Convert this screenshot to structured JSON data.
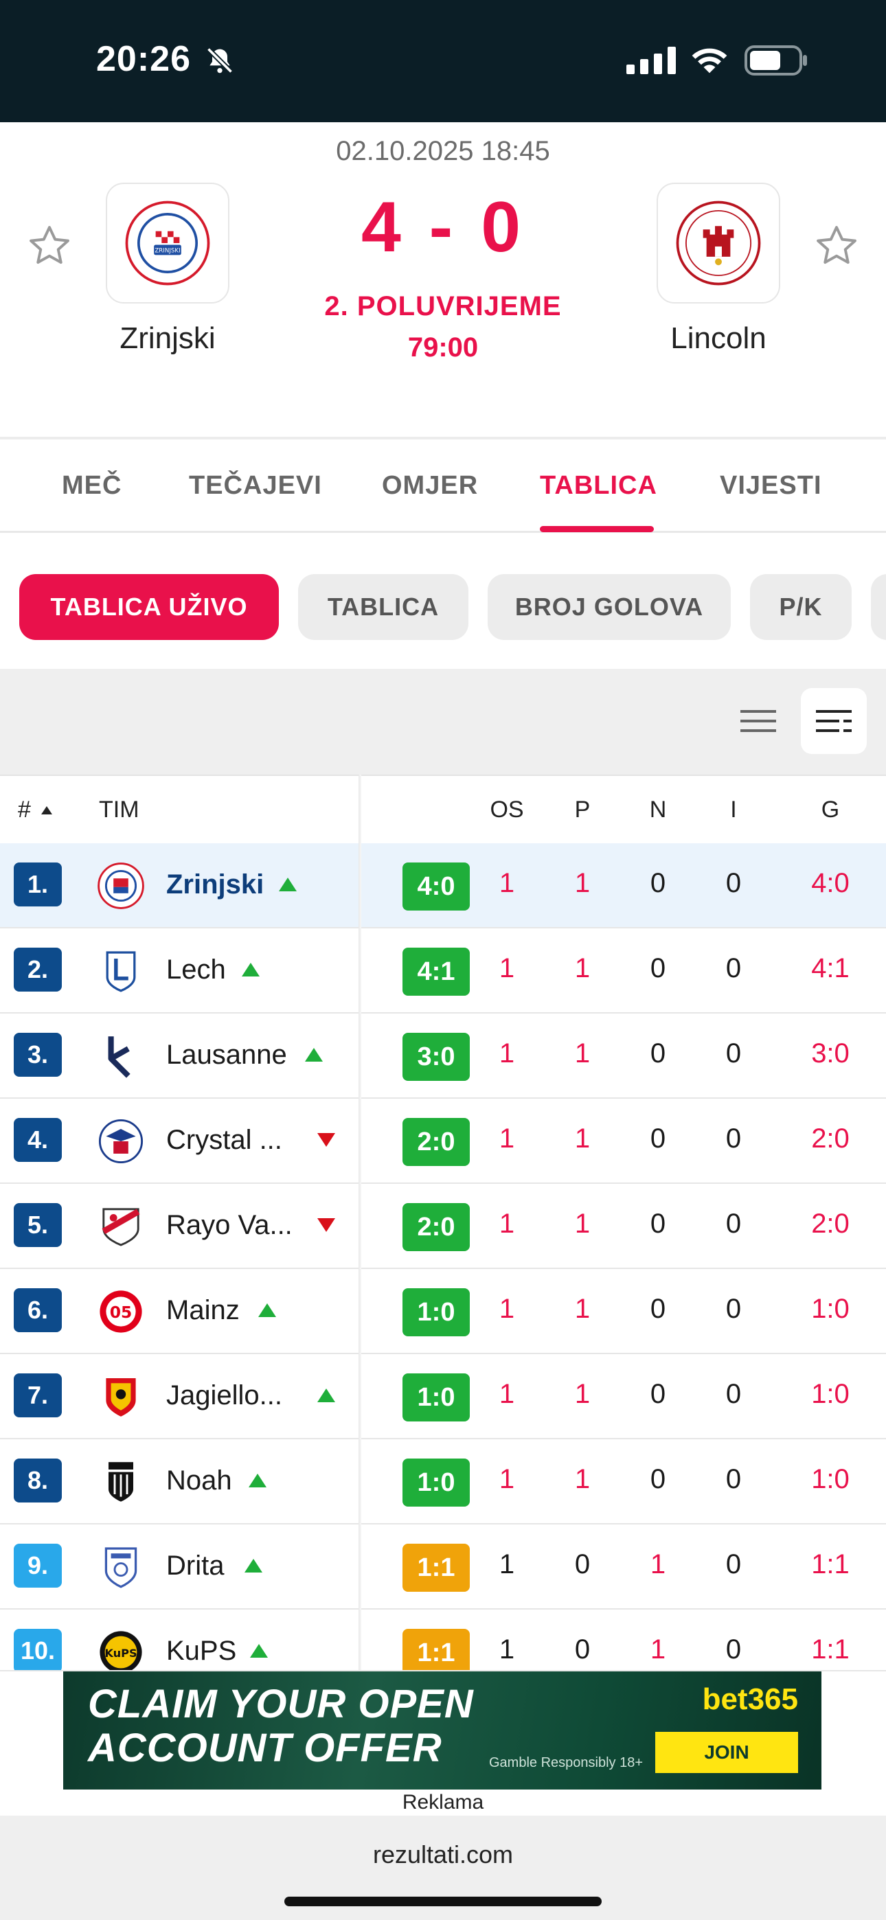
{
  "status_bar": {
    "time": "20:26"
  },
  "match": {
    "datetime": "02.10.2025 18:45",
    "home_team": "Zrinjski",
    "away_team": "Lincoln",
    "score": "4 - 0",
    "period": "2. POLUVRIJEME",
    "minute": "79:00",
    "home_logo_label": "ZRINJSKI",
    "away_logo_label": "LINCOLN RED IMPS"
  },
  "tabs": [
    {
      "label": "MEČ"
    },
    {
      "label": "TEČAJEVI"
    },
    {
      "label": "OMJER"
    },
    {
      "label": "TABLICA",
      "active": true
    },
    {
      "label": "VIJESTI"
    }
  ],
  "filter_pills": [
    {
      "label": "TABLICA UŽIVO",
      "active": true
    },
    {
      "label": "TABLICA"
    },
    {
      "label": "BROJ GOLOVA"
    },
    {
      "label": "P/K"
    }
  ],
  "table": {
    "headers": {
      "rank": "#",
      "team": "TIM",
      "played": "OS",
      "won": "P",
      "draw": "N",
      "lost": "I",
      "goals": "G"
    },
    "rows": [
      {
        "rank": "1.",
        "team": "Zrinjski",
        "trend": "up",
        "form": "4:0",
        "form_color": "green",
        "os": "1",
        "p": "1",
        "n": "0",
        "i": "0",
        "g": "4:0"
      },
      {
        "rank": "2.",
        "team": "Lech",
        "trend": "up",
        "form": "4:1",
        "form_color": "green",
        "os": "1",
        "p": "1",
        "n": "0",
        "i": "0",
        "g": "4:1"
      },
      {
        "rank": "3.",
        "team": "Lausanne",
        "trend": "up",
        "form": "3:0",
        "form_color": "green",
        "os": "1",
        "p": "1",
        "n": "0",
        "i": "0",
        "g": "3:0"
      },
      {
        "rank": "4.",
        "team": "Crystal ...",
        "trend": "down",
        "form": "2:0",
        "form_color": "green",
        "os": "1",
        "p": "1",
        "n": "0",
        "i": "0",
        "g": "2:0"
      },
      {
        "rank": "5.",
        "team": "Rayo Va...",
        "trend": "down",
        "form": "2:0",
        "form_color": "green",
        "os": "1",
        "p": "1",
        "n": "0",
        "i": "0",
        "g": "2:0"
      },
      {
        "rank": "6.",
        "team": "Mainz",
        "trend": "up",
        "form": "1:0",
        "form_color": "green",
        "os": "1",
        "p": "1",
        "n": "0",
        "i": "0",
        "g": "1:0"
      },
      {
        "rank": "7.",
        "team": "Jagiello...",
        "trend": "up",
        "form": "1:0",
        "form_color": "green",
        "os": "1",
        "p": "1",
        "n": "0",
        "i": "0",
        "g": "1:0"
      },
      {
        "rank": "8.",
        "team": "Noah",
        "trend": "up",
        "form": "1:0",
        "form_color": "green",
        "os": "1",
        "p": "1",
        "n": "0",
        "i": "0",
        "g": "1:0"
      },
      {
        "rank": "9.",
        "team": "Drita",
        "trend": "up",
        "form": "1:1",
        "form_color": "orange",
        "os": "1",
        "p": "0",
        "n": "1",
        "i": "0",
        "g": "1:1"
      },
      {
        "rank": "10.",
        "team": "KuPS",
        "trend": "up",
        "form": "1:1",
        "form_color": "orange",
        "os": "1",
        "p": "0",
        "n": "1",
        "i": "0",
        "g": "1:1"
      }
    ]
  },
  "ad": {
    "line1": "CLAIM YOUR OPEN",
    "line2": "ACCOUNT OFFER",
    "brand": "bet365",
    "join": "JOIN",
    "responsible": "Gamble Responsibly  18+",
    "label": "Reklama"
  },
  "footer": {
    "url": "rezultati.com"
  },
  "colors": {
    "accent": "#e9114b",
    "rank_dark": "#0d4b8b",
    "rank_light": "#29a8ea",
    "form_win": "#1fae3a",
    "form_draw": "#f0a30a"
  }
}
